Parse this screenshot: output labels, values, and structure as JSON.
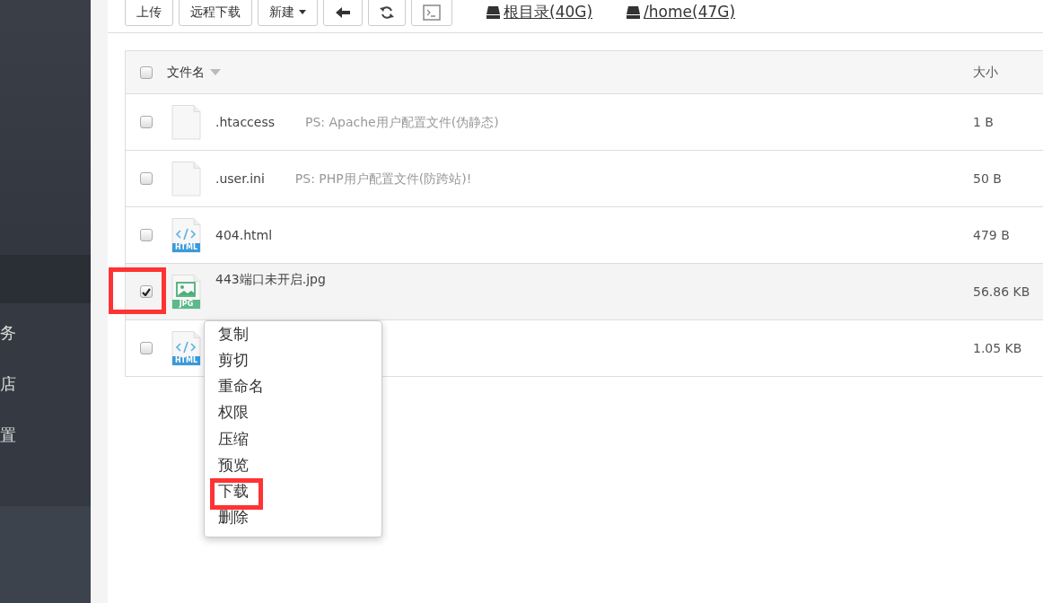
{
  "sidebar": {
    "items": [
      {
        "selected": true
      },
      {
        "label": "务",
        "selected": false
      },
      {
        "label": "店",
        "selected": false
      },
      {
        "label": "置",
        "selected": false
      }
    ]
  },
  "toolbar": {
    "buttons": [
      {
        "kind": "text",
        "label": "上传"
      },
      {
        "kind": "text",
        "label": "远程下载"
      },
      {
        "kind": "dropdown",
        "label": "新建"
      },
      {
        "kind": "back"
      },
      {
        "kind": "refresh"
      },
      {
        "kind": "terminal"
      }
    ],
    "drives": [
      {
        "label": "根目录(40G)"
      },
      {
        "label": "/home(47G)"
      }
    ]
  },
  "table": {
    "select_all": {
      "checked": false
    },
    "columns": [
      {
        "label": "文件名"
      },
      {
        "label": "大小"
      }
    ],
    "rows": [
      {
        "checked": false,
        "highlight": false,
        "kind": "blank",
        "name": ".htaccess",
        "note": "PS: Apache用户配置文件(伪静态)",
        "size": "1 B"
      },
      {
        "checked": false,
        "highlight": false,
        "kind": "blank",
        "name": ".user.ini",
        "note": "PS: PHP用户配置文件(防跨站)!",
        "size": "50 B"
      },
      {
        "checked": false,
        "highlight": false,
        "kind": "html",
        "badge": "HTML",
        "name": "404.html",
        "size": "479 B"
      },
      {
        "checked": true,
        "highlight": true,
        "kind": "jpg",
        "badge": "JPG",
        "name": "443端口未开启.jpg",
        "size": "56.86 KB"
      },
      {
        "checked": false,
        "highlight": false,
        "kind": "html",
        "badge": "HTML",
        "size": "1.05 KB"
      }
    ]
  },
  "context_menu": {
    "items": [
      {
        "label": "复制",
        "highlight": false
      },
      {
        "label": "剪切",
        "highlight": false
      },
      {
        "label": "重命名",
        "highlight": false
      },
      {
        "label": "权限",
        "highlight": false
      },
      {
        "label": "压缩",
        "highlight": false
      },
      {
        "label": "预览",
        "highlight": false
      },
      {
        "label": "下载",
        "highlight": true
      },
      {
        "label": "删除",
        "highlight": false
      }
    ]
  }
}
